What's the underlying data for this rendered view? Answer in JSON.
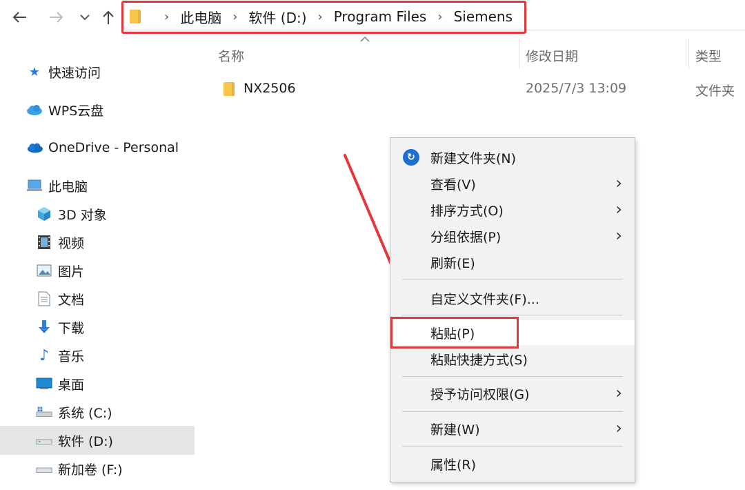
{
  "nav": {
    "back_icon": "arrow-left-icon",
    "forward_icon": "arrow-right-icon",
    "recent_icon": "chevron-down-icon",
    "up_icon": "arrow-up-icon"
  },
  "breadcrumb": [
    "此电脑",
    "软件 (D:)",
    "Program Files",
    "Siemens"
  ],
  "sidebar": {
    "items": [
      {
        "label": "快速访问",
        "icon": "star-icon"
      },
      {
        "label": "WPS云盘",
        "icon": "cloud-icon"
      },
      {
        "label": "OneDrive - Personal",
        "icon": "onedrive-icon"
      },
      {
        "label": "此电脑",
        "icon": "computer-icon"
      },
      {
        "label": "3D 对象",
        "icon": "cube-icon"
      },
      {
        "label": "视频",
        "icon": "film-icon"
      },
      {
        "label": "图片",
        "icon": "image-icon"
      },
      {
        "label": "文档",
        "icon": "document-icon"
      },
      {
        "label": "下载",
        "icon": "download-icon"
      },
      {
        "label": "音乐",
        "icon": "music-icon"
      },
      {
        "label": "桌面",
        "icon": "desktop-icon"
      },
      {
        "label": "系统 (C:)",
        "icon": "drive-icon"
      },
      {
        "label": "软件 (D:)",
        "icon": "drive-icon"
      },
      {
        "label": "新加卷 (F:)",
        "icon": "drive-icon"
      }
    ],
    "selected": "软件 (D:)"
  },
  "columns": {
    "name": "名称",
    "modified": "修改日期",
    "type": "类型"
  },
  "files": [
    {
      "name": "NX2506",
      "modified": "2025/7/3 13:09",
      "type": "文件夹"
    }
  ],
  "context_menu": {
    "items": [
      {
        "label": "新建文件夹(N)",
        "submenu": false
      },
      {
        "label": "查看(V)",
        "submenu": true
      },
      {
        "label": "排序方式(O)",
        "submenu": true
      },
      {
        "label": "分组依据(P)",
        "submenu": true
      },
      {
        "label": "刷新(E)",
        "submenu": false
      },
      {
        "label": "自定义文件夹(F)...",
        "submenu": false
      },
      {
        "label": "粘贴(P)",
        "submenu": false
      },
      {
        "label": "粘贴快捷方式(S)",
        "submenu": false
      },
      {
        "label": "授予访问权限(G)",
        "submenu": true
      },
      {
        "label": "新建(W)",
        "submenu": true
      },
      {
        "label": "属性(R)",
        "submenu": false
      }
    ],
    "highlighted": "粘贴(P)"
  },
  "colors": {
    "annotation_red": "#e0383c",
    "accent_blue": "#1f6fd1",
    "folder_yellow": "#f5c64a"
  }
}
